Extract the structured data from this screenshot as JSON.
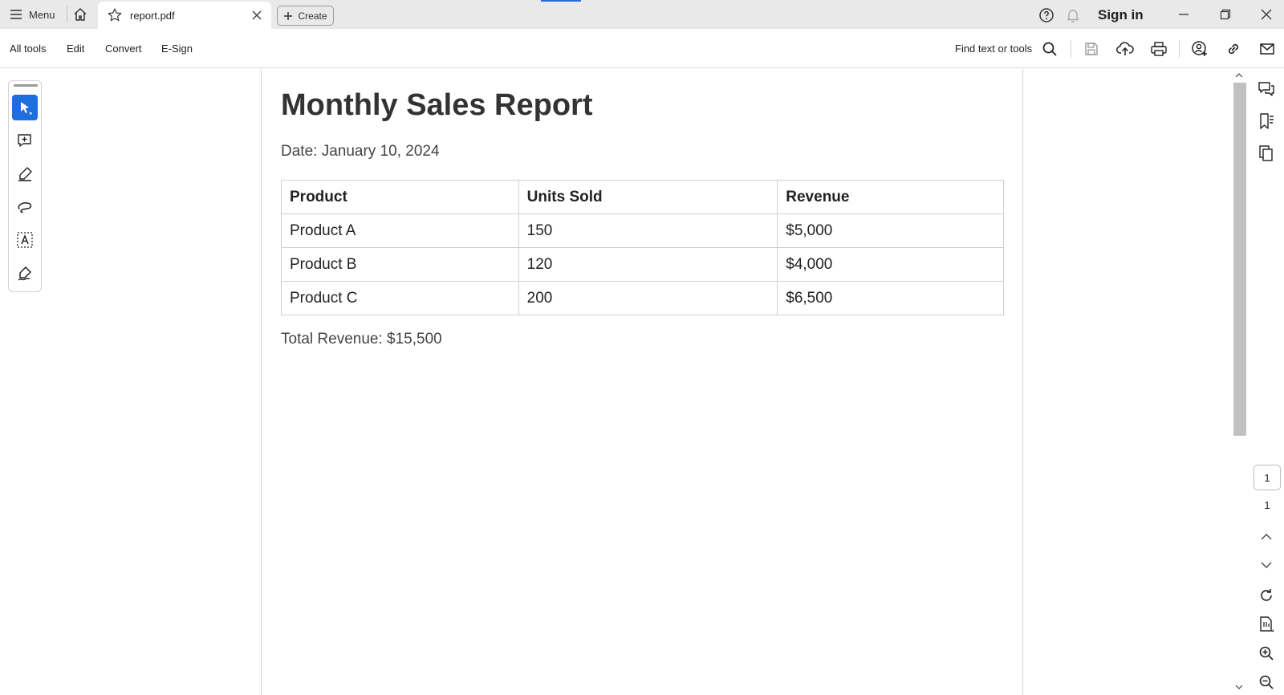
{
  "tabbar": {
    "menu_label": "Menu",
    "tab_title": "report.pdf",
    "create_label": "Create",
    "signin_label": "Sign in"
  },
  "toolbar": {
    "items": [
      "All tools",
      "Edit",
      "Convert",
      "E-Sign"
    ],
    "find_label": "Find text or tools"
  },
  "document": {
    "title": "Monthly Sales Report",
    "date": "Date: January 10, 2024",
    "table": {
      "headers": [
        "Product",
        "Units Sold",
        "Revenue"
      ],
      "rows": [
        [
          "Product A",
          "150",
          "$5,000"
        ],
        [
          "Product B",
          "120",
          "$4,000"
        ],
        [
          "Product C",
          "200",
          "$6,500"
        ]
      ]
    },
    "total": "Total Revenue: $15,500"
  },
  "pagination": {
    "current_page": "1",
    "total_pages": "1"
  },
  "colors": {
    "accent": "#1e6ee0",
    "tabbar_bg": "#e9e9e9"
  },
  "icons": {
    "left_tools": [
      "select-arrow-icon",
      "add-comment-icon",
      "highlight-pen-icon",
      "draw-freehand-icon",
      "text-box-icon",
      "sign-icon"
    ],
    "right_rail": [
      "comments-icon",
      "bookmarks-icon",
      "pages-icon",
      "rotate-icon",
      "page-fit-icon",
      "zoom-in-icon",
      "zoom-out-icon"
    ]
  }
}
